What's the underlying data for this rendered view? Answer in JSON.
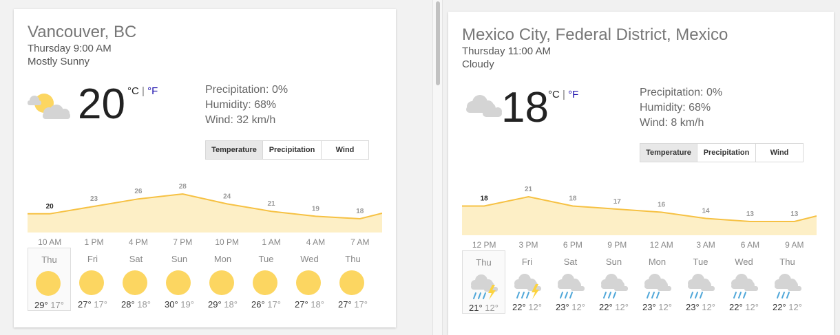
{
  "left": {
    "location": "Vancouver, BC",
    "datetime": "Thursday 9:00 AM",
    "condition": "Mostly Sunny",
    "current_icon": "partly-sunny-icon",
    "temperature": "20",
    "unit_c": "°C",
    "unit_sep": "|",
    "unit_f": "°F",
    "precipitation": "Precipitation: 0%",
    "humidity": "Humidity: 68%",
    "wind": "Wind: 32 km/h",
    "tabs": [
      "Temperature",
      "Precipitation",
      "Wind"
    ],
    "active_tab": "Temperature",
    "chart_data": {
      "type": "area",
      "labels": [
        "20",
        "23",
        "26",
        "28",
        "24",
        "21",
        "19",
        "18"
      ],
      "values": [
        20,
        23,
        26,
        28,
        24,
        21,
        19,
        18
      ],
      "x_ticks": [
        "10 AM",
        "1 PM",
        "4 PM",
        "7 PM",
        "10 PM",
        "1 AM",
        "4 AM",
        "7 AM"
      ]
    },
    "days": [
      {
        "name": "Thu",
        "icon": "sun-icon",
        "hi": "29°",
        "lo": "17°",
        "selected": true
      },
      {
        "name": "Fri",
        "icon": "sun-icon",
        "hi": "27°",
        "lo": "17°"
      },
      {
        "name": "Sat",
        "icon": "sun-icon",
        "hi": "28°",
        "lo": "18°"
      },
      {
        "name": "Sun",
        "icon": "sun-icon",
        "hi": "30°",
        "lo": "19°"
      },
      {
        "name": "Mon",
        "icon": "sun-icon",
        "hi": "29°",
        "lo": "18°"
      },
      {
        "name": "Tue",
        "icon": "sun-icon",
        "hi": "26°",
        "lo": "17°"
      },
      {
        "name": "Wed",
        "icon": "sun-icon",
        "hi": "27°",
        "lo": "18°"
      },
      {
        "name": "Thu",
        "icon": "sun-icon",
        "hi": "27°",
        "lo": "17°"
      }
    ]
  },
  "right": {
    "location": "Mexico City, Federal District, Mexico",
    "datetime": "Thursday 11:00 AM",
    "condition": "Cloudy",
    "current_icon": "cloud-icon",
    "temperature": "18",
    "unit_c": "°C",
    "unit_sep": "|",
    "unit_f": "°F",
    "precipitation": "Precipitation: 0%",
    "humidity": "Humidity: 68%",
    "wind": "Wind: 8 km/h",
    "tabs": [
      "Temperature",
      "Precipitation",
      "Wind"
    ],
    "active_tab": "Temperature",
    "chart_data": {
      "type": "area",
      "labels": [
        "18",
        "21",
        "18",
        "17",
        "16",
        "14",
        "13",
        "13"
      ],
      "values": [
        18,
        21,
        18,
        17,
        16,
        14,
        13,
        13
      ],
      "x_ticks": [
        "12 PM",
        "3 PM",
        "6 PM",
        "9 PM",
        "12 AM",
        "3 AM",
        "6 AM",
        "9 AM"
      ]
    },
    "days": [
      {
        "name": "Thu",
        "icon": "thunderstorm-icon",
        "hi": "21°",
        "lo": "12°",
        "selected": true
      },
      {
        "name": "Fri",
        "icon": "thunderstorm-icon",
        "hi": "22°",
        "lo": "12°"
      },
      {
        "name": "Sat",
        "icon": "rain-cloud-icon",
        "hi": "23°",
        "lo": "12°"
      },
      {
        "name": "Sun",
        "icon": "rain-cloud-icon",
        "hi": "22°",
        "lo": "12°"
      },
      {
        "name": "Mon",
        "icon": "rain-cloud-icon",
        "hi": "23°",
        "lo": "12°"
      },
      {
        "name": "Tue",
        "icon": "rain-cloud-icon",
        "hi": "23°",
        "lo": "12°"
      },
      {
        "name": "Wed",
        "icon": "rain-cloud-icon",
        "hi": "22°",
        "lo": "12°"
      },
      {
        "name": "Thu",
        "icon": "rain-cloud-icon",
        "hi": "22°",
        "lo": "12°"
      }
    ]
  },
  "colors": {
    "chart_line": "#f6c143",
    "chart_fill": "#fdefc6",
    "sun": "#fcd661",
    "cloud": "#d4d4d4",
    "rain": "#4fa7d9",
    "bolt": "#fcd33f"
  }
}
